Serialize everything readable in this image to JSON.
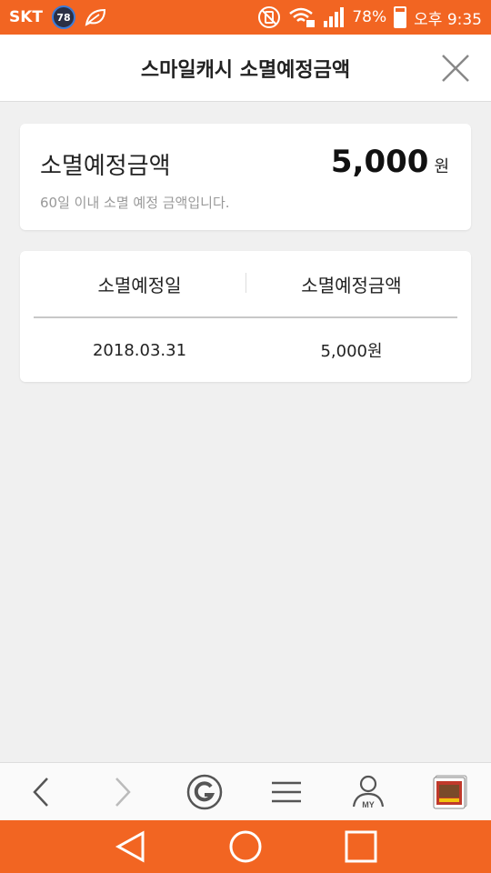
{
  "status_bar": {
    "carrier": "SKT",
    "badge": "78",
    "battery": "78%",
    "time": "오후 9:35",
    "battery_level": 0.78
  },
  "header": {
    "title": "스마일캐시 소멸예정금액"
  },
  "summary": {
    "label": "소멸예정금액",
    "amount": "5,000",
    "unit": "원",
    "description": "60일 이내 소멸 예정 금액입니다."
  },
  "table": {
    "headers": [
      "소멸예정일",
      "소멸예정금액"
    ],
    "rows": [
      [
        "2018.03.31",
        "5,000원"
      ]
    ]
  },
  "bottom_bar": {
    "my_label": "MY"
  },
  "colors": {
    "brand": "#f26522",
    "background": "#f0f0f0"
  }
}
